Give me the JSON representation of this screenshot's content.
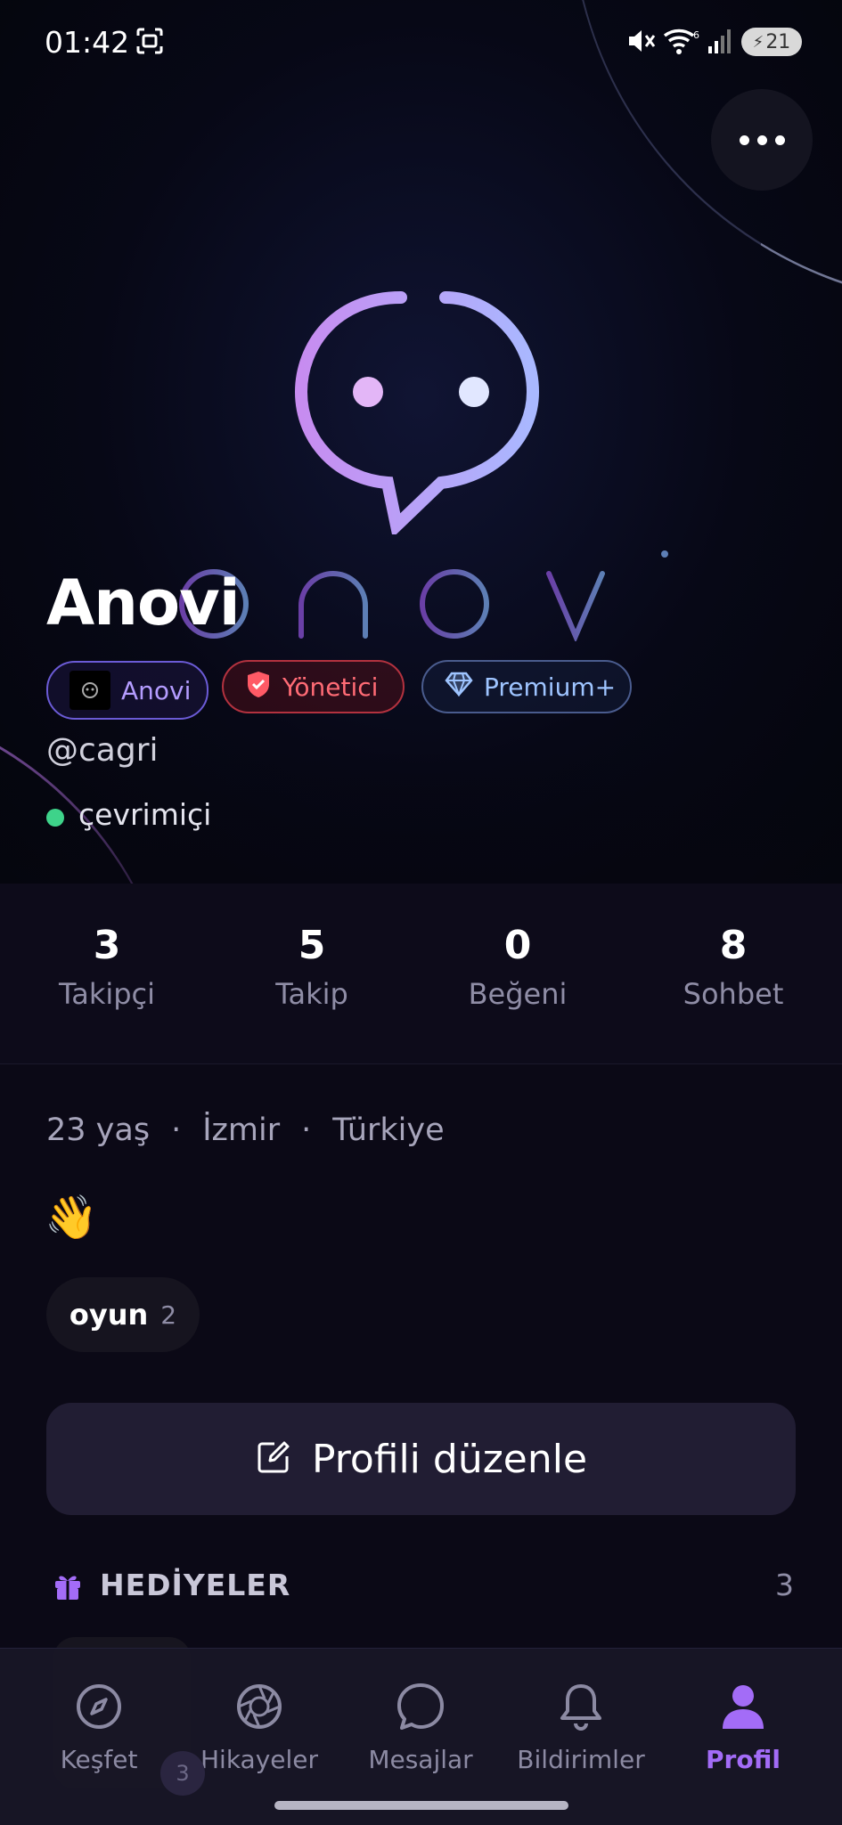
{
  "status_bar": {
    "time": "01:42",
    "battery": "21",
    "icons": [
      "screenshot-icon",
      "mute-icon",
      "wifi-icon",
      "signal-icon",
      "battery-icon"
    ]
  },
  "hero": {
    "logo_text": "anovi",
    "more_icon": "more-horizontal-icon"
  },
  "profile": {
    "display_name": "Anovi",
    "badges": [
      {
        "label": "Anovi",
        "icon": "anovi-mini-icon",
        "color": "#b49cff"
      },
      {
        "label": "Yönetici",
        "icon": "shield-check-icon",
        "color": "#ff6b75"
      },
      {
        "label": "Premium+",
        "icon": "diamond-icon",
        "color": "#9ec4ff"
      }
    ],
    "handle": "@cagri",
    "status": "çevrimiçi",
    "status_color": "#3ed38a"
  },
  "stats": [
    {
      "value": "3",
      "label": "Takipçi"
    },
    {
      "value": "5",
      "label": "Takip"
    },
    {
      "value": "0",
      "label": "Beğeni"
    },
    {
      "value": "8",
      "label": "Sohbet"
    }
  ],
  "info": {
    "age": "23 yaş",
    "separator": "·",
    "city": "İzmir",
    "country": "Türkiye",
    "bio_emoji": "👋"
  },
  "interests": [
    {
      "label": "oyun",
      "count": "2"
    }
  ],
  "edit_button": {
    "label": "Profili düzenle",
    "icon": "edit-icon"
  },
  "gifts": {
    "title": "HEDİYELER",
    "count": "3",
    "icon": "gift-icon"
  },
  "bottom_nav": {
    "items": [
      {
        "label": "Keşfet",
        "icon": "compass-icon",
        "active": false
      },
      {
        "label": "Hikayeler",
        "icon": "aperture-icon",
        "active": false
      },
      {
        "label": "Mesajlar",
        "icon": "chat-bubble-icon",
        "active": false
      },
      {
        "label": "Bildirimler",
        "icon": "bell-icon",
        "active": false
      },
      {
        "label": "Profil",
        "icon": "user-icon",
        "active": true
      }
    ],
    "badge": "3",
    "accent": "#a36cf7"
  }
}
